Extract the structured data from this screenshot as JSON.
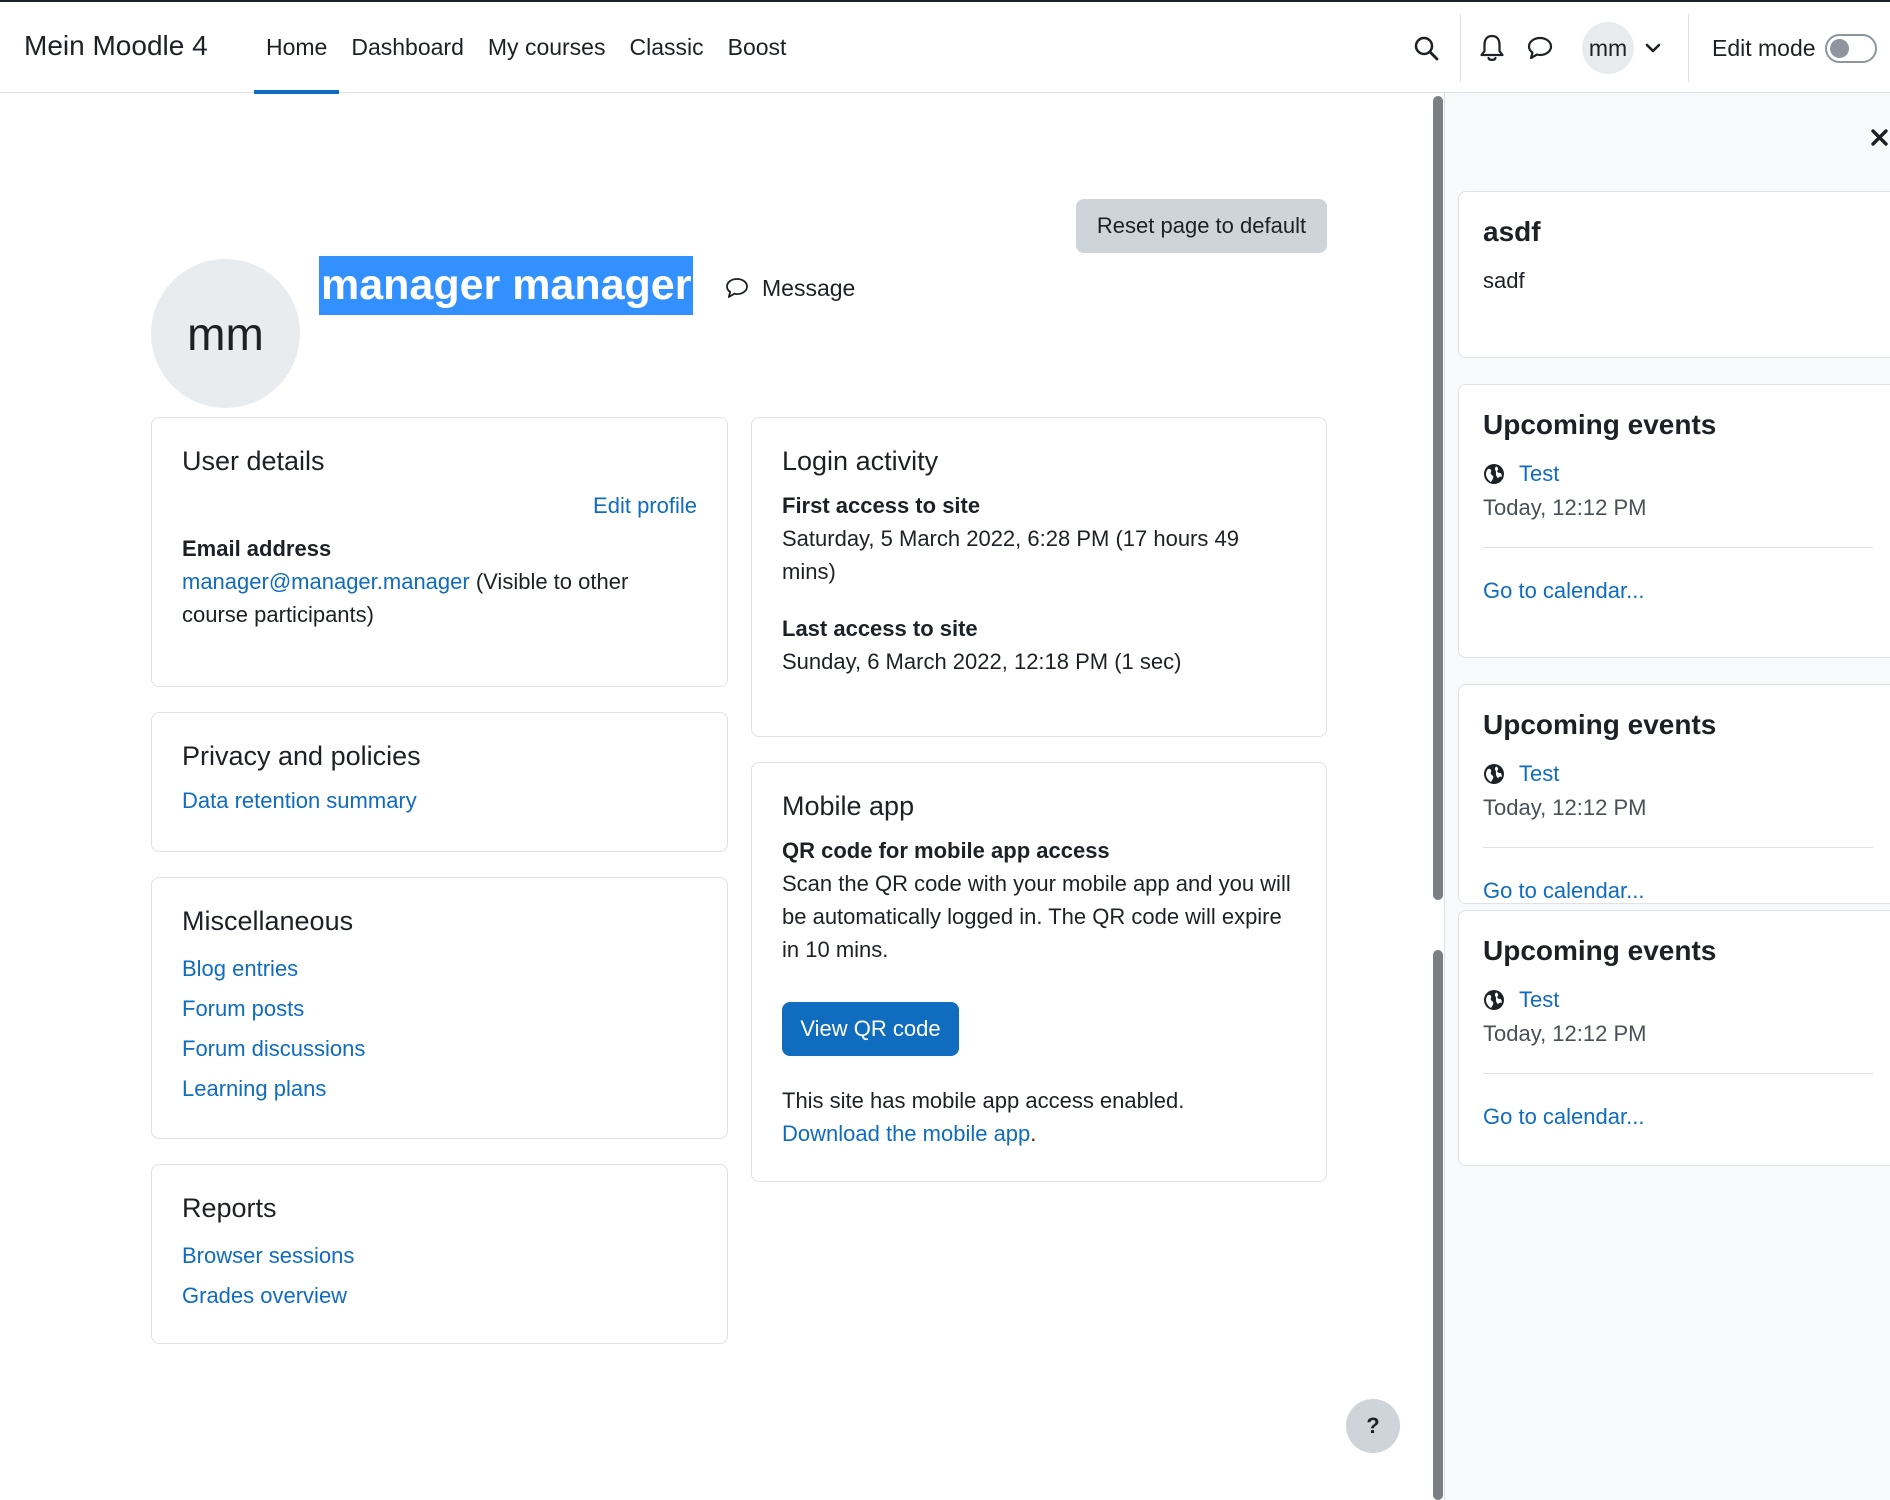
{
  "navbar": {
    "brand": "Mein Moodle 4",
    "items": [
      {
        "label": "Home",
        "active": true
      },
      {
        "label": "Dashboard",
        "active": false
      },
      {
        "label": "My courses",
        "active": false
      },
      {
        "label": "Classic",
        "active": false
      },
      {
        "label": "Boost",
        "active": false
      }
    ],
    "user_initials": "mm",
    "edit_mode_label": "Edit mode",
    "edit_mode_on": false
  },
  "main": {
    "reset_label": "Reset page to default",
    "profile": {
      "initials": "mm",
      "name": "manager manager",
      "message_label": "Message"
    },
    "user_details": {
      "title": "User details",
      "edit_profile": "Edit profile",
      "email_label": "Email address",
      "email": "manager@manager.manager",
      "email_note": " (Visible to other course participants)"
    },
    "privacy": {
      "title": "Privacy and policies",
      "link": "Data retention summary"
    },
    "misc": {
      "title": "Miscellaneous",
      "links": [
        "Blog entries",
        "Forum posts",
        "Forum discussions",
        "Learning plans"
      ]
    },
    "reports": {
      "title": "Reports",
      "links": [
        "Browser sessions",
        "Grades overview"
      ]
    },
    "login": {
      "title": "Login activity",
      "first_label": "First access to site",
      "first_value": "Saturday, 5 March 2022, 6:28 PM  (17 hours 49 mins)",
      "last_label": "Last access to site",
      "last_value": "Sunday, 6 March 2022, 12:18 PM  (1 sec)"
    },
    "mobile": {
      "title": "Mobile app",
      "qr_label": "QR code for mobile app access",
      "qr_text": "Scan the QR code with your mobile app and you will be automatically logged in. The QR code will expire in 10 mins.",
      "qr_button": "View QR code",
      "enabled_text": "This site has mobile app access enabled.",
      "download_link": "Download the mobile app",
      "download_suffix": "."
    },
    "help_label": "?"
  },
  "drawer": {
    "blocks": [
      {
        "title": "asdf",
        "text": "sadf"
      },
      {
        "title": "Upcoming events",
        "event": "Test",
        "time": "Today, 12:12 PM",
        "link": "Go to calendar..."
      },
      {
        "title": "Upcoming events",
        "event": "Test",
        "time": "Today, 12:12 PM",
        "link": "Go to calendar..."
      },
      {
        "title": "Upcoming events",
        "event": "Test",
        "time": "Today, 12:12 PM",
        "link": "Go to calendar..."
      }
    ]
  },
  "colors": {
    "link": "#0f6cbf",
    "primary_button": "#0f6cbf",
    "selection": "#3390ff",
    "secondary_button": "#ced4da",
    "drawer_bg": "#f8f9fa"
  }
}
